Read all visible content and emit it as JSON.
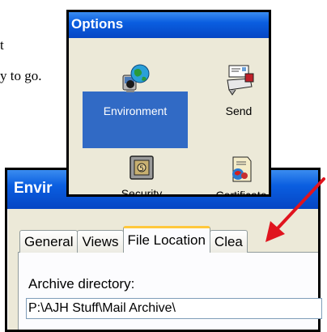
{
  "document": {
    "line1": "t",
    "line2": "y to go."
  },
  "options_window": {
    "title": "Options",
    "items": [
      {
        "label": "Environment",
        "icon": "environment-icon",
        "selected": true
      },
      {
        "label": "Send",
        "icon": "send-icon",
        "selected": false
      },
      {
        "label": "Security",
        "icon": "security-icon",
        "selected": false
      },
      {
        "label": "Certificate",
        "icon": "certificate-icon",
        "selected": false
      }
    ]
  },
  "environment_window": {
    "title": "Envir",
    "tabs": [
      {
        "label": "General",
        "active": false
      },
      {
        "label": "Views",
        "active": false
      },
      {
        "label": "File Location",
        "active": true
      },
      {
        "label": "Clea",
        "active": false
      }
    ],
    "archive_label": "Archive directory:",
    "archive_value": "P:\\AJH Stuff\\Mail Archive\\"
  },
  "colors": {
    "titlebar": "#0a5ee0",
    "selection": "#316ac5",
    "arrow": "#e0141e",
    "active_tab_accent": "#ffc83c"
  }
}
